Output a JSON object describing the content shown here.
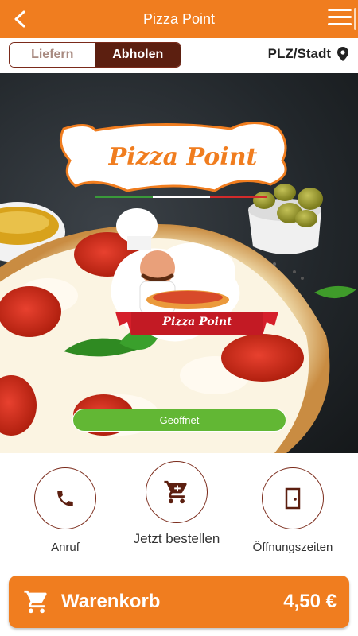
{
  "header": {
    "title": "Pizza Point"
  },
  "mode": {
    "deliver_label": "Liefern",
    "pickup_label": "Abholen",
    "selected": "Abholen"
  },
  "location": {
    "label": "PLZ/Stadt"
  },
  "hero": {
    "logo_text": "Pizza Point",
    "badge_text": "Pizza Point",
    "status_label": "Geöffnet"
  },
  "actions": {
    "call_label": "Anruf",
    "order_label": "Jetzt bestellen",
    "hours_label": "Öffnungszeiten"
  },
  "cart": {
    "label": "Warenkorb",
    "total": "4,50 €"
  },
  "colors": {
    "accent": "#f07d1f",
    "dark_brown": "#5c1f10",
    "open_green": "#62b734"
  }
}
